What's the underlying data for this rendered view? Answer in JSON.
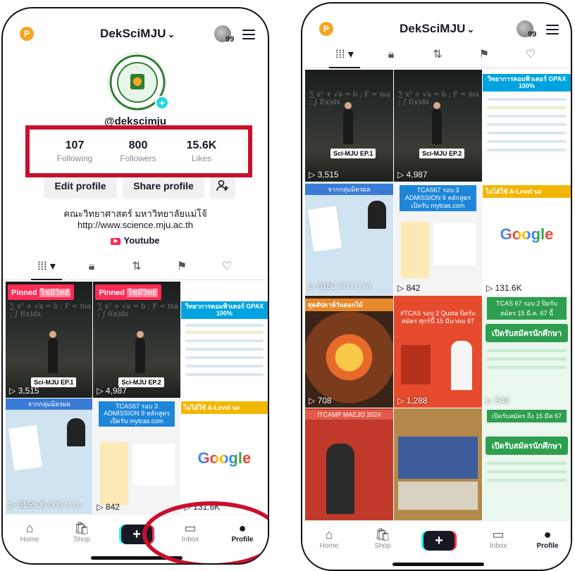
{
  "left": {
    "username": "DekSciMJU",
    "badge": "99",
    "handle": "@dekscimju",
    "stats": [
      {
        "value": "107",
        "label": "Following"
      },
      {
        "value": "800",
        "label": "Followers"
      },
      {
        "value": "15.6K",
        "label": "Likes"
      }
    ],
    "edit_profile": "Edit profile",
    "share_profile": "Share profile",
    "bio": "คณะวิทยาศาสตร์ มหาวิทยาลัยแม่โจ้",
    "link": "http://www.science.mju.ac.th",
    "youtube": "Youtube",
    "pinned": "Pinned",
    "pinned_sub": "ไข่มีวิทย์",
    "posts": {
      "ep1": "Sci-MJU EP.1",
      "ep2": "Sci-MJU EP.2",
      "v1": "3,515",
      "v2": "4,987",
      "v3": "615",
      "v3_overlay": "500,000 บาท",
      "v4": "842",
      "v5": "131.6K",
      "comp_title": "วิทยาการคอมพิวเตอร์ GPAX 100%",
      "tcas_title": "TCAS67 รอบ 3 ADMISSION 9 หลักสูตร เปิดรับ mytcas.com",
      "group_title": "จากกลุ่มมิตรผล",
      "alevel": "ไม่ได้ใช้ A-Level นะ",
      "google": "Google"
    }
  },
  "right": {
    "username": "DekSciMJU",
    "badge": "99",
    "posts": {
      "ep1": "Sci-MJU EP.1",
      "ep2": "Sci-MJU EP.2",
      "v1": "3,515",
      "v2": "4,987",
      "v3": "615",
      "v3_overlay": "0,000 บาท",
      "v4": "842",
      "v5": "131.6K",
      "v6": "708",
      "v7": "1,288",
      "v8": "543",
      "group_title": "จากกลุ่มมิตรผล",
      "tcas_title": "TCAS67 รอบ 3 ADMISSION 9 หลักสูตร เปิดรับ mytcas.com",
      "alevel": "ไม่ได้ใช้ A-Level นะ",
      "google": "Google",
      "flower_title": "สุดสัปดาห์วันดอกไม้",
      "tcas2_title": "#TCAS รอบ 2 Quota ปิดรับสมัคร ศุกร์นี้ 15 มีนาคม 67",
      "tcas_date": "TCAS 67 รอบ 2 ปิดรับสมัคร 15 มี.ค. 67 นี้",
      "open_title": "เปิดรับสมัครนักศึกษา",
      "open_date": "เปิดรับสมัคร ถึง 15 มีค 67",
      "camp_title": "ITCAMP MAEJO 2024",
      "comp_title": "วิทยาการคอมพิวเตอร์ GPAX 100%"
    }
  },
  "nav": {
    "home": "Home",
    "shop": "Shop",
    "plus": "+",
    "inbox": "Inbox",
    "profile": "Profile"
  },
  "colors": {
    "annotation": "#c8102e",
    "tiktok_red": "#fe2c55",
    "tiktok_cyan": "#25f4ee"
  },
  "icons": [
    "p-coin-icon",
    "chevron-down-icon",
    "menu-icon",
    "videos-grid-icon",
    "lock-icon",
    "repost-icon",
    "liked-icon",
    "favorites-icon",
    "add-friend-icon",
    "youtube-icon",
    "play-icon",
    "home-icon",
    "shop-icon",
    "plus-icon",
    "inbox-icon",
    "profile-icon"
  ]
}
